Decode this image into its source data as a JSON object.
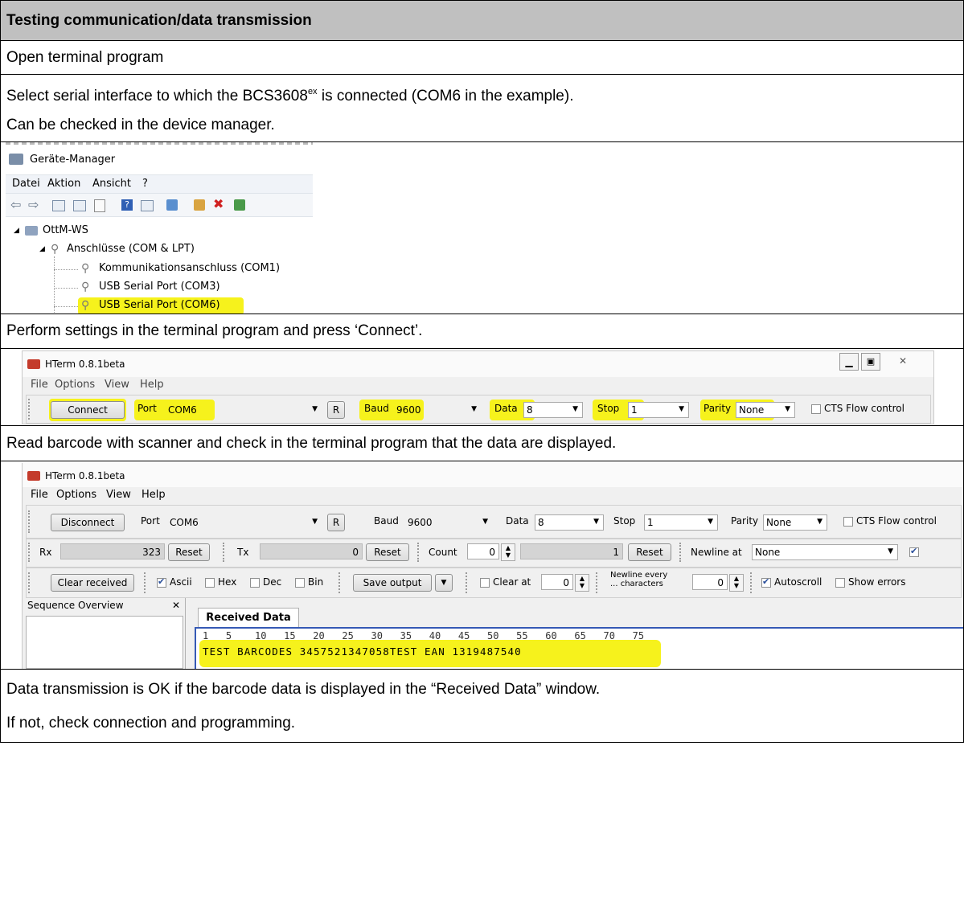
{
  "doc": {
    "heading": "Testing communication/data transmission",
    "step1": "Open terminal program",
    "step2_line1_a": "Select serial interface to which the BCS3608",
    "step2_line1_sup": "ex",
    "step2_line1_b": " is connected (COM6 in the example).",
    "step2_line2": "Can be checked in the device manager.",
    "step3": "Perform settings in the terminal program and press ‘Connect’.",
    "step4": "Read barcode with scanner and check in the terminal program that the data are displayed.",
    "result_line1": "Data transmission is OK if the barcode data is displayed in the “Received Data” window.",
    "result_line2": "If not, check connection and programming."
  },
  "device_manager": {
    "title": "Geräte-Manager",
    "menu": [
      "Datei",
      "Aktion",
      "Ansicht",
      "?"
    ],
    "tree": {
      "root": "OttM-WS",
      "group": "Anschlüsse (COM & LPT)",
      "ports": [
        "Kommunikationsanschluss (COM1)",
        "USB Serial Port (COM3)",
        "USB Serial Port (COM6)"
      ]
    }
  },
  "hterm_connect": {
    "title": "HTerm 0.8.1beta",
    "menu": [
      "File",
      "Options",
      "View",
      "Help"
    ],
    "connect_label": "Connect",
    "port_label": "Port",
    "port_value": "COM6",
    "r_label": "R",
    "baud_label": "Baud",
    "baud_value": "9600",
    "data_label": "Data",
    "data_value": "8",
    "stop_label": "Stop",
    "stop_value": "1",
    "parity_label": "Parity",
    "parity_value": "None",
    "cts_label": "CTS Flow control"
  },
  "hterm_data": {
    "title": "HTerm 0.8.1beta",
    "menu": [
      "File",
      "Options",
      "View",
      "Help"
    ],
    "disconnect_label": "Disconnect",
    "port_label": "Port",
    "port_value": "COM6",
    "r_label": "R",
    "baud_label": "Baud",
    "baud_value": "9600",
    "data_label": "Data",
    "data_value": "8",
    "stop_label": "Stop",
    "stop_value": "1",
    "parity_label": "Parity",
    "parity_value": "None",
    "cts_label": "CTS Flow control",
    "rx_label": "Rx",
    "rx_value": "323",
    "tx_label": "Tx",
    "tx_value": "0",
    "reset_label": "Reset",
    "count_label": "Count",
    "count_value": "0",
    "count_total": "1",
    "newline_at_label": "Newline at",
    "newline_at_value": "None",
    "clear_received_label": "Clear received",
    "ascii_label": "Ascii",
    "hex_label": "Hex",
    "dec_label": "Dec",
    "bin_label": "Bin",
    "save_output_label": "Save output",
    "clear_at_label": "Clear at",
    "clear_at_value": "0",
    "newline_every_line1": "Newline every",
    "newline_every_line2": "... characters",
    "newline_every_value": "0",
    "autoscroll_label": "Autoscroll",
    "show_errors_label": "Show errors",
    "sequence_overview_label": "Sequence Overview",
    "close_glyph": "✕",
    "received_tab_label": "Received Data",
    "ruler": "1   5    10   15   20   25   30   35   40   45   50   55   60   65   70   75",
    "received_text": "TEST BARCODES 3457521347058TEST EAN 1319487540"
  }
}
